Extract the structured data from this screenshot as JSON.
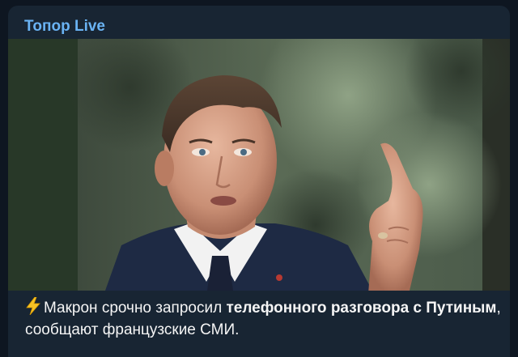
{
  "message": {
    "channel_name": "Топор Live",
    "photo": {
      "alt_icon": "news-photo"
    },
    "caption": {
      "icon": "lightning-bolt-icon",
      "part1": "Макрон срочно запросил ",
      "bold1": "телефонного разговора с Путиным",
      "part2": ", сообщают французские СМИ."
    }
  },
  "colors": {
    "app_background": "#0e1621",
    "bubble_background": "#182533",
    "channel_name": "#6ab3f3",
    "caption_text": "#f5f5f5"
  }
}
